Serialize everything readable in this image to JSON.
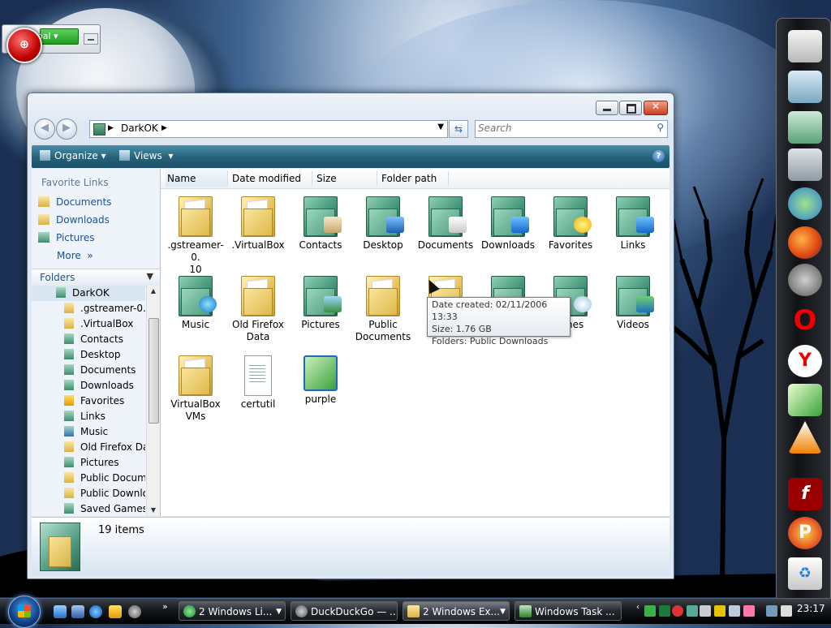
{
  "gadget": {
    "label": "oal"
  },
  "window": {
    "address": {
      "crumb": "DarkOK"
    },
    "search": {
      "placeholder": "Search"
    },
    "commands": {
      "organize": "Organize",
      "views": "Views"
    },
    "favorites": {
      "heading": "Favorite Links",
      "items": [
        "Documents",
        "Downloads",
        "Pictures"
      ],
      "more": "More"
    },
    "folders": {
      "heading": "Folders",
      "items": [
        "DarkOK",
        ".gstreamer-0.10",
        ".VirtualBox",
        "Contacts",
        "Desktop",
        "Documents",
        "Downloads",
        "Favorites",
        "Links",
        "Music",
        "Old Firefox Dat",
        "Pictures",
        "Public Docume",
        "Public Downlo",
        "Saved Games"
      ]
    },
    "columns": [
      "Name",
      "Date modified",
      "Size",
      "Folder path"
    ],
    "items": [
      {
        "l1": ".gstreamer-0.",
        "l2": "10"
      },
      {
        "l1": ".VirtualBox",
        "l2": ""
      },
      {
        "l1": "Contacts",
        "l2": ""
      },
      {
        "l1": "Desktop",
        "l2": ""
      },
      {
        "l1": "Documents",
        "l2": ""
      },
      {
        "l1": "Downloads",
        "l2": ""
      },
      {
        "l1": "Favorites",
        "l2": ""
      },
      {
        "l1": "Links",
        "l2": ""
      },
      {
        "l1": "Music",
        "l2": ""
      },
      {
        "l1": "Old Firefox",
        "l2": "Data"
      },
      {
        "l1": "Pictures",
        "l2": ""
      },
      {
        "l1": "Public",
        "l2": "Documents"
      },
      {
        "l1": "D",
        "l2": ""
      },
      {
        "l1": "",
        "l2": ""
      },
      {
        "l1": "rches",
        "l2": ""
      },
      {
        "l1": "Videos",
        "l2": ""
      },
      {
        "l1": "VirtualBox",
        "l2": "VMs"
      },
      {
        "l1": "certutil",
        "l2": ""
      },
      {
        "l1": "purple",
        "l2": ""
      }
    ],
    "tooltip": {
      "date": "Date created: 02/11/2006 13:33",
      "size": "Size: 1.76 GB",
      "folders": "Folders: Public Downloads"
    },
    "details": {
      "count": "19 items"
    }
  },
  "taskbar": {
    "buttons": [
      "2 Windows Li...",
      "DuckDuckGo — ...",
      "2 Windows Ex...",
      "Windows Task ..."
    ],
    "clock": "23:17"
  },
  "colors": {
    "accent": "#25617b",
    "link": "#1c4f96",
    "selection": "#dbe6f3"
  }
}
